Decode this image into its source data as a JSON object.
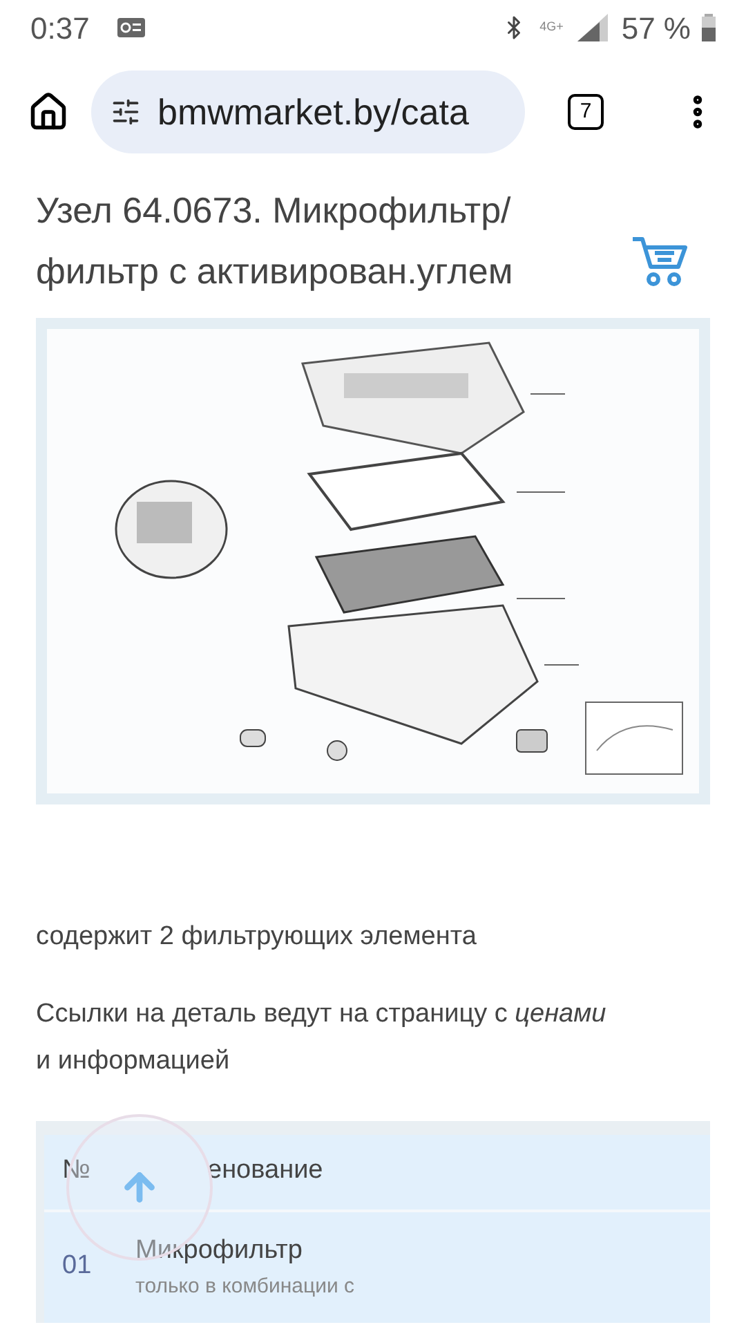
{
  "status_bar": {
    "time": "0:37",
    "network": "4G+",
    "battery": "57 %"
  },
  "browser": {
    "url": "bmwmarket.by/cata",
    "tab_count": "7"
  },
  "title": "Узел 64.0673. Микрофильтр/ фильтр с активирован.углем",
  "diagram": {
    "kind": "picture"
  },
  "note": "содержит 2 фильтрующих элемента",
  "links_note": "Ссылки на деталь ведут на страницу с *ценами* и информацией",
  "table": {
    "columns": [
      "№",
      "енование"
    ],
    "rows": [
      {
        "number": "01",
        "name": "Микрофильтр",
        "detail": "только в комбинации с"
      }
    ]
  }
}
